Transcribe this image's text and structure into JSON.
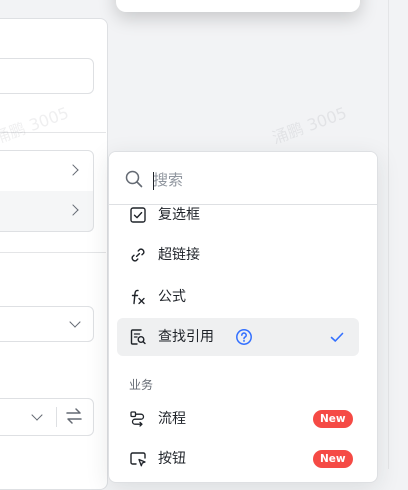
{
  "watermark": {
    "text": "涌鹏 3005"
  },
  "menu": {
    "search": {
      "placeholder": "搜索",
      "icon": "search-icon"
    },
    "items": [
      {
        "label": "复选框",
        "icon": "checkbox-icon"
      },
      {
        "label": "超链接",
        "icon": "link-icon"
      },
      {
        "label": "公式",
        "icon": "formula-icon"
      },
      {
        "label": "查找引用",
        "icon": "lookup-icon",
        "selected": true,
        "help_icon": "help-circle-icon",
        "check_icon": "check-icon"
      }
    ],
    "group_business": {
      "label": "业务",
      "items": [
        {
          "label": "流程",
          "icon": "flow-icon",
          "badge": "New"
        },
        {
          "label": "按钮",
          "icon": "button-icon",
          "badge": "New"
        }
      ]
    }
  },
  "colors": {
    "accent": "#3370ff",
    "badge": "#f54a45",
    "selected_bg": "#eff0f1",
    "text": "#1f2329",
    "muted": "#646a73"
  }
}
